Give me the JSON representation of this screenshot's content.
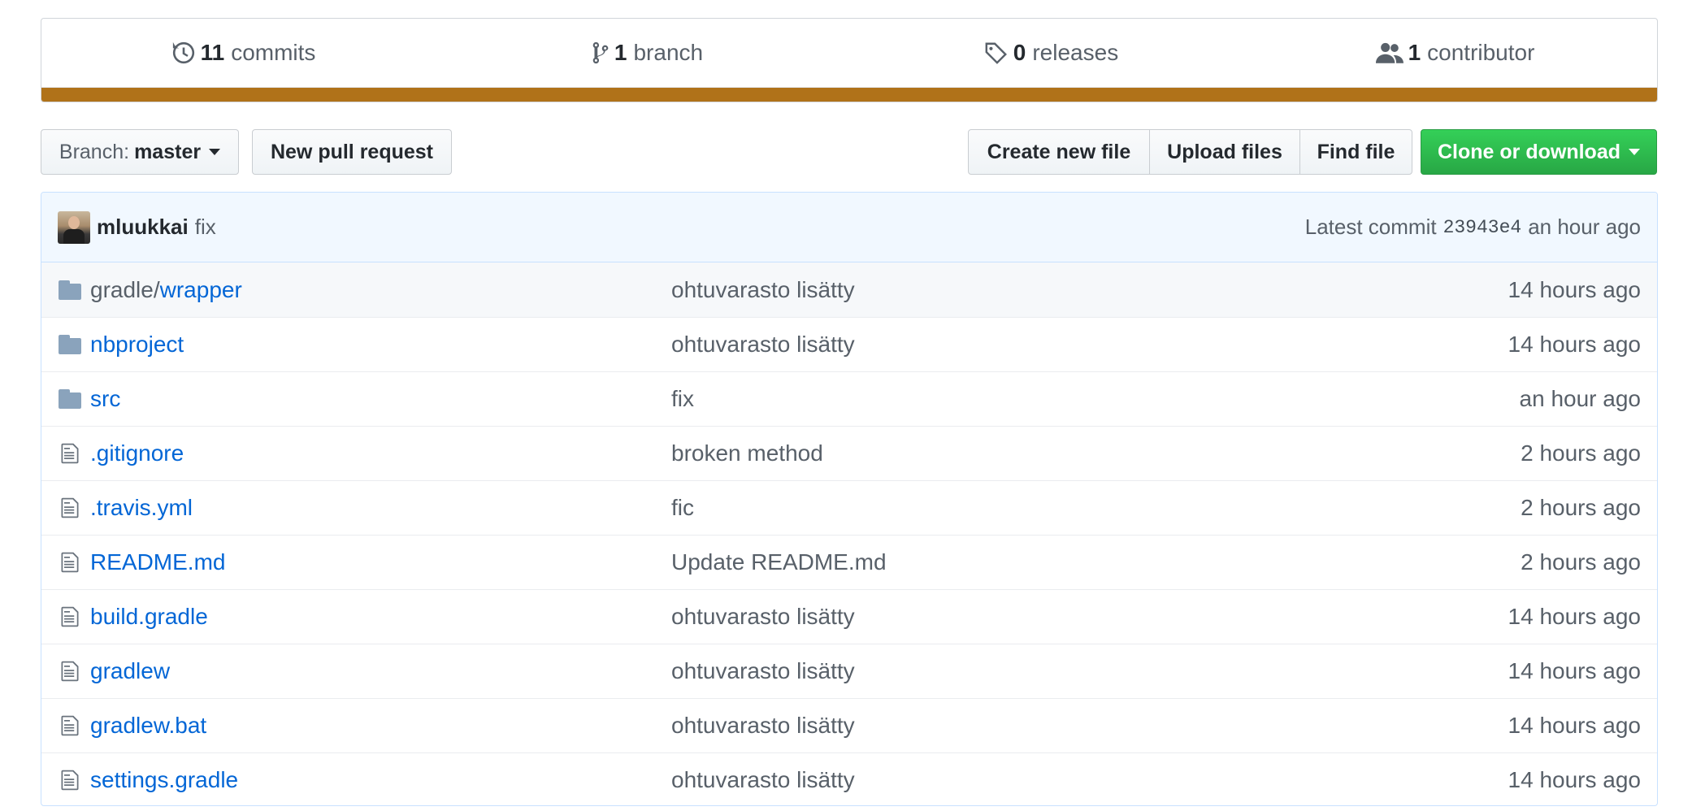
{
  "summary": {
    "commits": {
      "count": "11",
      "label": "commits",
      "icon": "history-icon"
    },
    "branches": {
      "count": "1",
      "label": "branch",
      "icon": "git-branch-icon"
    },
    "releases": {
      "count": "0",
      "label": "releases",
      "icon": "tag-icon"
    },
    "contributors": {
      "count": "1",
      "label": "contributor",
      "icon": "people-icon"
    },
    "language_bar_color": "#b07219"
  },
  "toolbar": {
    "branch_prefix": "Branch:",
    "branch_name": "master",
    "new_pull_request": "New pull request",
    "create_new_file": "Create new file",
    "upload_files": "Upload files",
    "find_file": "Find file",
    "clone_or_download": "Clone or download",
    "clone_color": "#28a745"
  },
  "latest_commit": {
    "author": "mluukkai",
    "message": "fix",
    "label": "Latest commit",
    "sha": "23943e4",
    "age": "an hour ago"
  },
  "files": [
    {
      "type": "directory",
      "prefix": "gradle/",
      "name": "wrapper",
      "message": "ohtuvarasto lisätty",
      "age": "14 hours ago"
    },
    {
      "type": "directory",
      "prefix": "",
      "name": "nbproject",
      "message": "ohtuvarasto lisätty",
      "age": "14 hours ago"
    },
    {
      "type": "directory",
      "prefix": "",
      "name": "src",
      "message": "fix",
      "age": "an hour ago"
    },
    {
      "type": "file",
      "prefix": "",
      "name": ".gitignore",
      "message": "broken method",
      "age": "2 hours ago"
    },
    {
      "type": "file",
      "prefix": "",
      "name": ".travis.yml",
      "message": "fic",
      "age": "2 hours ago"
    },
    {
      "type": "file",
      "prefix": "",
      "name": "README.md",
      "message": "Update README.md",
      "age": "2 hours ago"
    },
    {
      "type": "file",
      "prefix": "",
      "name": "build.gradle",
      "message": "ohtuvarasto lisätty",
      "age": "14 hours ago"
    },
    {
      "type": "file",
      "prefix": "",
      "name": "gradlew",
      "message": "ohtuvarasto lisätty",
      "age": "14 hours ago"
    },
    {
      "type": "file",
      "prefix": "",
      "name": "gradlew.bat",
      "message": "ohtuvarasto lisätty",
      "age": "14 hours ago"
    },
    {
      "type": "file",
      "prefix": "",
      "name": "settings.gradle",
      "message": "ohtuvarasto lisätty",
      "age": "14 hours ago"
    }
  ]
}
